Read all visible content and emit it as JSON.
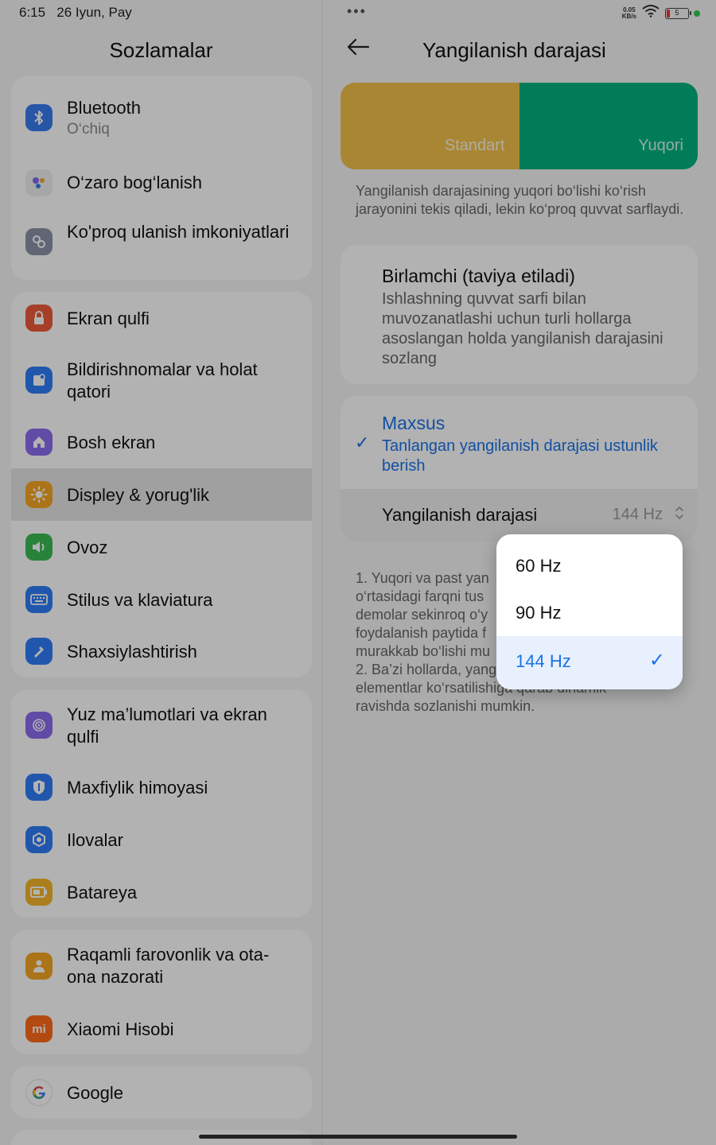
{
  "status_bar": {
    "time": "6:15",
    "date": "26 Iyun, Pay",
    "net_speed_value": "0.05",
    "net_speed_unit": "KB/s",
    "battery_level": "5",
    "dots": "•••"
  },
  "left": {
    "title": "Sozlamalar",
    "groups": [
      [
        {
          "label": "Bluetooth",
          "sub": "O‘chiq",
          "icon": "bluetooth-icon",
          "color": "#3a7bf0"
        },
        {
          "label": "O‘zaro bog‘lanish",
          "icon": "dots-icon",
          "color": "#f0f0f0"
        },
        {
          "label": "Ko'proq ulanish imkoniyatlari",
          "icon": "link-icon",
          "color": "#8c93a8"
        }
      ],
      [
        {
          "label": "Ekran qulfi",
          "icon": "lock-icon",
          "color": "#ee5a3a"
        },
        {
          "label": "Bildirishnomalar va holat qatori",
          "icon": "notification-icon",
          "color": "#2f7df6"
        },
        {
          "label": "Bosh ekran",
          "icon": "home-icon",
          "color": "#8a6cf0"
        },
        {
          "label": "Displey & yorug'lik",
          "icon": "sun-icon",
          "color": "#f5a623",
          "selected": true
        },
        {
          "label": "Ovoz",
          "icon": "speaker-icon",
          "color": "#3cba54"
        },
        {
          "label": "Stilus va klaviatura",
          "icon": "keyboard-icon",
          "color": "#2f7df6"
        },
        {
          "label": "Shaxsiylashtirish",
          "icon": "brush-icon",
          "color": "#2f7df6"
        }
      ],
      [
        {
          "label": "Yuz ma’lumotlari va ekran qulfi",
          "icon": "fingerprint-icon",
          "color": "#8a6cf0"
        },
        {
          "label": "Maxfiylik himoyasi",
          "icon": "shield-icon",
          "color": "#2f7df6"
        },
        {
          "label": "Ilovalar",
          "icon": "gear-icon",
          "color": "#2f7df6"
        },
        {
          "label": "Batareya",
          "icon": "battery-icon",
          "color": "#f5b62a"
        }
      ],
      [
        {
          "label": "Raqamli farovonlik va ota-ona nazorati",
          "icon": "family-icon",
          "color": "#f5a623"
        },
        {
          "label": "Xiaomi Hisobi",
          "icon": "mi-icon",
          "color": "#ff6a1a"
        }
      ],
      [
        {
          "label": "Google",
          "icon": "google-icon",
          "color": "#ffffff"
        }
      ]
    ]
  },
  "right": {
    "back_icon": "back-arrow-icon",
    "title": "Yangilanish darajasi",
    "preview": {
      "standard": "Standart",
      "high": "Yuqori",
      "standard_color": "#f2c04b",
      "high_color": "#00b37f"
    },
    "description": "Yangilanish darajasining yuqori bo‘lishi ko‘rish jarayonini tekis qiladi, lekin ko‘proq quvvat sarflaydi.",
    "option_default": {
      "title": "Birlamchi (taviya etiladi)",
      "desc": "Ishlashning quvvat sarfi bilan muvozanatlashi uchun turli hollarga asoslangan holda yangilanish darajasini sozlang"
    },
    "option_custom": {
      "title": "Maxsus",
      "desc": "Tanlangan yangilanish darajasi ustunlik berish",
      "checked": true
    },
    "rate_row": {
      "label": "Yangilanish darajasi",
      "value": "144 Hz"
    },
    "notes_parts": [
      "1. Yuqori va past yan",
      "o‘rtasidagi farqni tus",
      "demolar sekinroq o‘y",
      "foydalanish paytida f",
      "murakkab bo‘lishi mu",
      "2. Ba’zi hollarda, yang",
      "elementlar ko‘rsatilishiga qarab dinamik",
      "ravishda sozlanishi mumkin."
    ]
  },
  "dropdown": {
    "options": [
      "60 Hz",
      "90 Hz",
      "144 Hz"
    ],
    "selected": "144 Hz"
  },
  "colors": {
    "accent": "#1a73e8"
  }
}
